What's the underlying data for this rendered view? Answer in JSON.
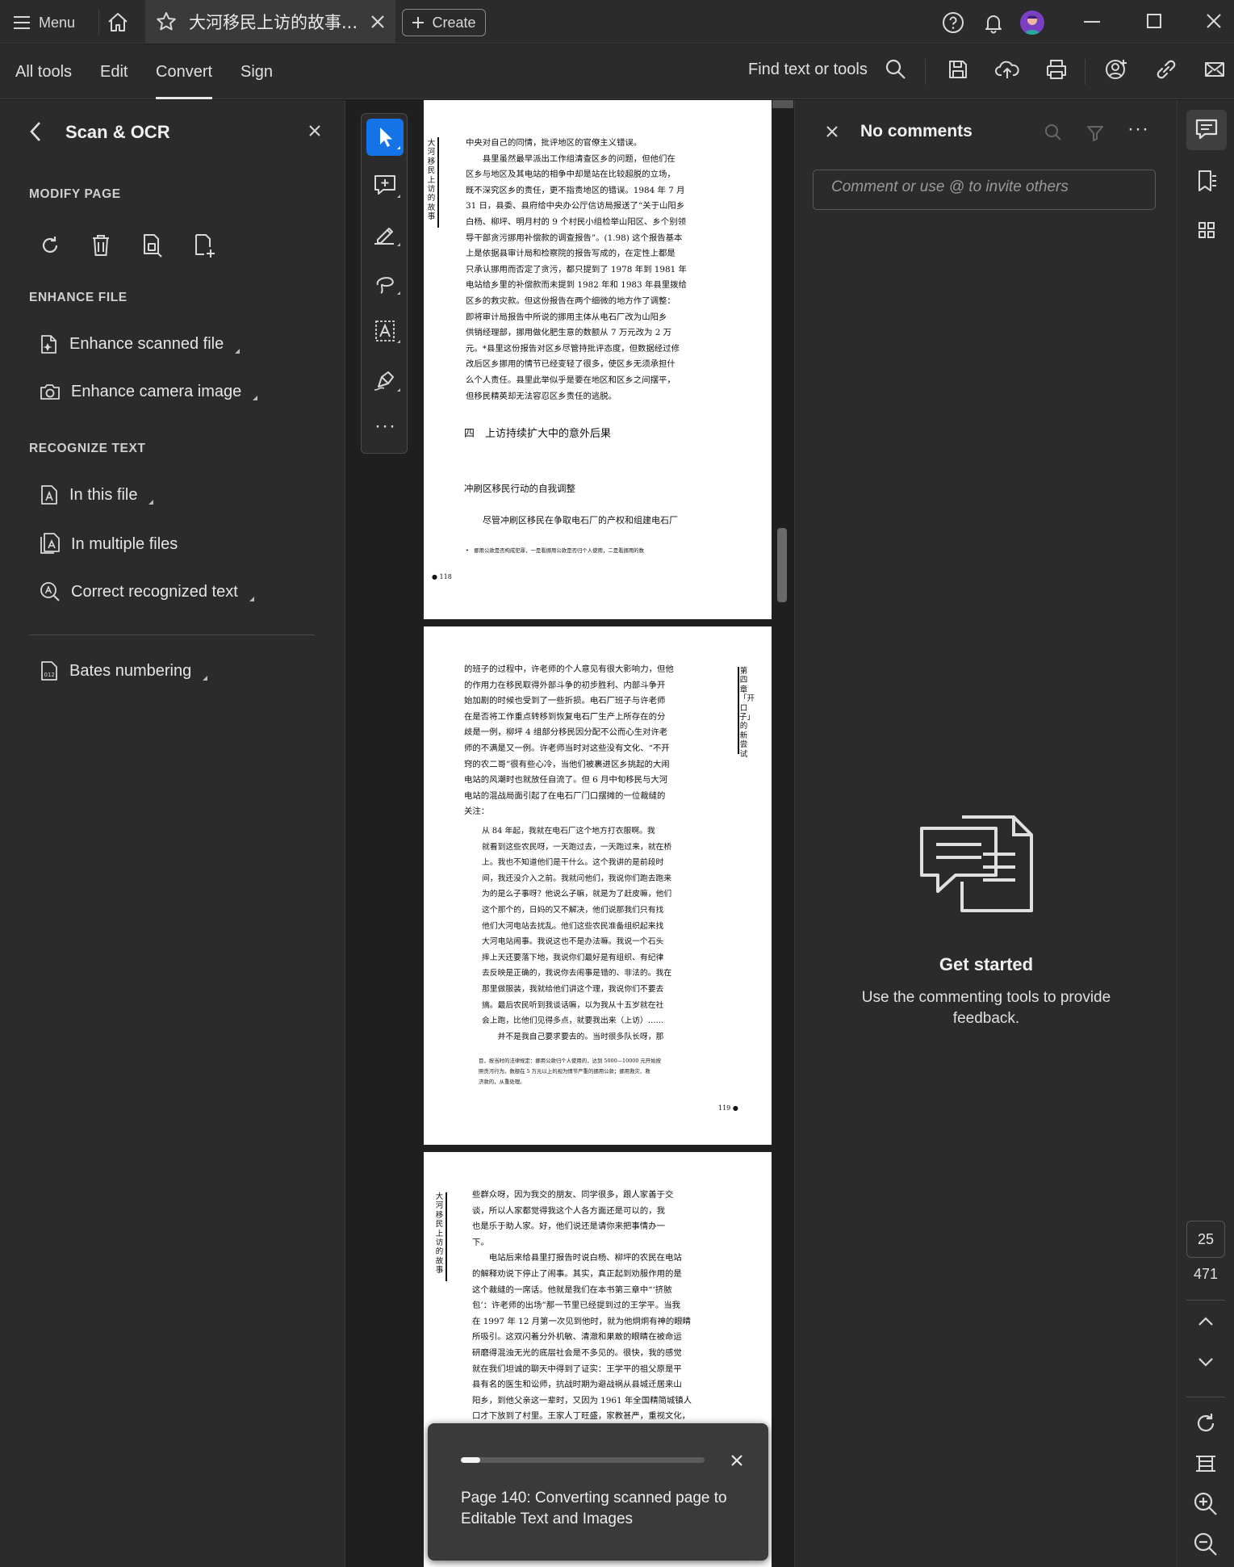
{
  "titlebar": {
    "menu_label": "Menu",
    "doc_tab_title": "大河移民上访的故事...",
    "create_label": "Create"
  },
  "toolbar": {
    "tabs": [
      {
        "label": "All tools",
        "active": false
      },
      {
        "label": "Edit",
        "active": false
      },
      {
        "label": "Convert",
        "active": true
      },
      {
        "label": "Sign",
        "active": false
      }
    ],
    "find_placeholder": "Find text or tools"
  },
  "left_panel": {
    "title": "Scan & OCR",
    "sections": {
      "modify_page": "MODIFY PAGE",
      "enhance_file": "ENHANCE FILE",
      "recognize_text": "RECOGNIZE TEXT"
    },
    "items": {
      "enhance_scanned": "Enhance scanned file",
      "enhance_camera": "Enhance camera image",
      "in_this_file": "In this file",
      "in_multiple_files": "In multiple files",
      "correct_text": "Correct recognized text",
      "bates": "Bates numbering"
    }
  },
  "document": {
    "page1": {
      "side_title": "大河移民上访的故事",
      "lines": [
        "中央对自己的同情，批评地区的官僚主义错误。",
        "　　县里虽然最早派出工作组清查区乡的问题，但他们在",
        "区乡与地区及其电站的相争中却是站在比较超脱的立场，",
        "既不深究区乡的责任，更不指责地区的错误。1984 年 7 月",
        "31 日，县委、县府给中央办公厅信访局报送了“关于山阳乡",
        "白杨、柳坪、明月村的 9 个村民小组检举山阳区、乡个别领",
        "导干部贪污挪用补偿款的调查报告”。(1.98) 这个报告基本",
        "上是依据县审计局和检察院的报告写成的，在定性上都是",
        "只承认挪用而否定了贪污，都只提到了 1978 年到 1981 年",
        "电站给乡里的补偿款而未提到 1982 年和 1983 年县里拨给",
        "区乡的救灾款。但这份报告在两个细微的地方作了调整：",
        "即将审计局报告中所说的挪用主体从电石厂改为山阳乡",
        "供销经理部，挪用做化肥生意的数额从 7 万元改为 2 万",
        "元。*县里这份报告对区乡尽管持批评态度，但数据经过修",
        "改后区乡挪用的情节已经变轻了很多，使区乡无须承担什",
        "么个人责任。县里此举似乎是要在地区和区乡之间摆平，",
        "但移民精英却无法容忍区乡责任的逃脱。"
      ],
      "heading": "四　上访持续扩大中的意外后果",
      "subheading": "冲刷区移民行动的自我调整",
      "para": "尽管冲刷区移民在争取电石厂的产权和组建电石厂",
      "footnote": "•　挪用公款是否构成犯罪，一是看挪用公款是否归个人使用，二是看挪用的数",
      "page_number": "● 118"
    },
    "page2": {
      "side_title": "第四章「开口子」的新尝试",
      "lines": [
        "的班子的过程中，许老师的个人意见有很大影响力，但他",
        "的作用力在移民取得外部斗争的初步胜利、内部斗争开",
        "始加剧的时候也受到了一些折损。电石厂班子与许老师",
        "在是否将工作重点转移到恢复电石厂生产上所存在的分",
        "歧是一例，柳坪 4 组部分移民因分配不公而心生对许老",
        "师的不满是又一例。许老师当时对这些没有文化、“不开",
        "窍的农二哥”很有些心冷，当他们被裹进区乡挑起的大闹",
        "电站的风潮时也就放任自流了。但 6 月中旬移民与大河",
        "电站的混战局面引起了在电石厂门口摆摊的一位裁缝的",
        "关注："
      ],
      "quote": [
        "从 84 年起，我就在电石厂这个地方打衣服啊。我",
        "就看到这些农民呀，一天跑过去，一天跑过来，就在桥",
        "上。我也不知道他们是干什么。这个我讲的是前段时",
        "间，我还没介入之前。我就问他们，我说你们跑去跑来",
        "为的是么子事呀？他说么子嘛，就是为了赶皮嘛，他们",
        "这个那个的，日妈的又不解决，他们说那我们只有找",
        "他们大河电站去扰乱。他们这些农民准备组织起来找",
        "大河电站闹事。我说这也不是办法嘛。我说一个石头",
        "摔上天还要落下地，我说你们最好是有组织、有纪律",
        "去反映是正确的，我说你去闹事是错的、非法的。我在",
        "那里做服装，我就给他们讲这个理，我说你们不要去",
        "搞。最后农民听到我谈话嘛，以为我从十五岁就在社",
        "会上跑，比他们见得多点，就要我出来（上访）……",
        "　　并不是我自己要求要去的。当时很多队长呀，那"
      ],
      "footnote": [
        "目，按当时的法律规定：挪用公款归个人使用的，达到 5000—10000 元开始按",
        "照贪污行为。数额在 5 万元以上的视为情节严重的挪用公款；挪用救灾、救",
        "济款的，从重处理。"
      ],
      "page_number": "119 ●"
    },
    "page3": {
      "side_title": "大河移民上访的故事",
      "lines": [
        "些群众呀，因为我交的朋友、同学很多，跟人家善于交",
        "谈，所以人家都觉得我这个人各方面还是可以的，我",
        "也是乐于助人家。好，他们说还是请你来把事情办一",
        "下。",
        "　　电站后来给县里打报告时说白杨、柳坪的农民在电站",
        "的解释劝说下停止了闹事。其实，真正起到劝服作用的是",
        "这个裁缝的一席话。他就是我们在本书第三章中“‘挤脓",
        "包’：许老师的出场”那一节里已经提到过的王学平。当我",
        "在 1997 年 12 月第一次见到他时，就为他炯炯有神的眼睛",
        "所吸引。这双闪着分外机敏、清澈和果敢的眼睛在被命运",
        "研磨得混浊无光的底层社会是不多见的。很快，我的感觉",
        "就在我们坦诚的聊天中得到了证实：王学平的祖父原是平",
        "县有名的医生和讼师，抗战时期为避战祸从县城迁居来山",
        "阳乡，到他父亲这一辈时，又因为 1961 年全国精简城镇人",
        "口才下放到了村里。王家人丁旺盛，家教甚严，重视文化，"
      ]
    },
    "scroll_position_fraction": 0.3
  },
  "comments": {
    "title": "No comments",
    "input_placeholder": "Comment or use @ to invite others",
    "empty_title": "Get started",
    "empty_body": "Use the commenting tools to provide feedback."
  },
  "page_nav": {
    "current_page": "25",
    "total_pages": "471"
  },
  "toast": {
    "message": "Page 140: Converting scanned page to Editable Text and Images",
    "progress_fraction": 0.08
  },
  "colors": {
    "accent_blue": "#1473e6",
    "panel_bg": "#2b2b2b",
    "app_bg": "#1f1f1f"
  }
}
